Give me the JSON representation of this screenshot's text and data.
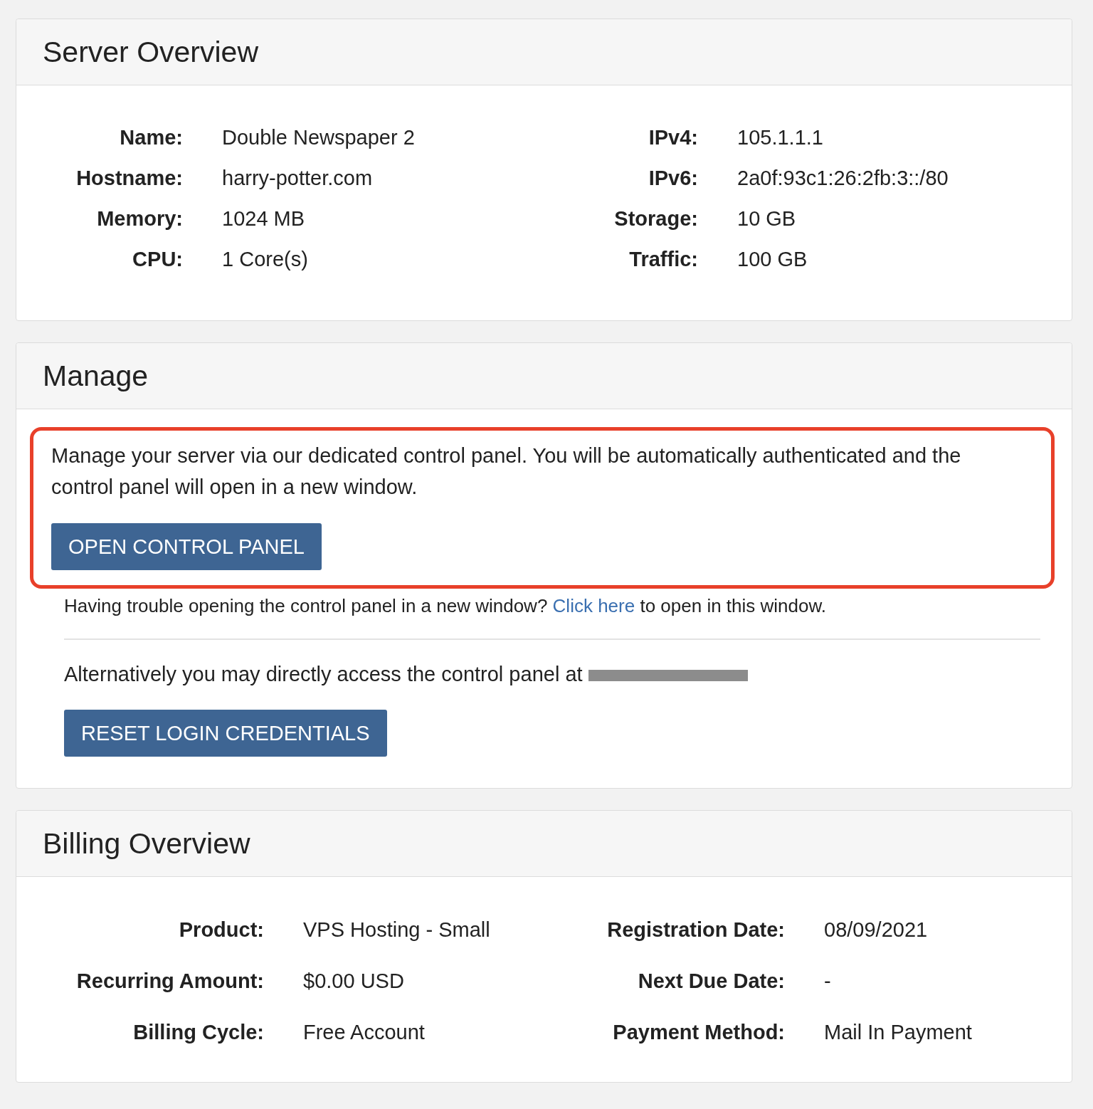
{
  "server_overview": {
    "title": "Server Overview",
    "left": [
      {
        "label": "Name:",
        "value": "Double Newspaper 2"
      },
      {
        "label": "Hostname:",
        "value": "harry-potter.com"
      },
      {
        "label": "Memory:",
        "value": "1024 MB"
      },
      {
        "label": "CPU:",
        "value": "1 Core(s)"
      }
    ],
    "right": [
      {
        "label": "IPv4:",
        "value": "105.1.1.1"
      },
      {
        "label": "IPv6:",
        "value": "2a0f:93c1:26:2fb:3::/80"
      },
      {
        "label": "Storage:",
        "value": "10 GB"
      },
      {
        "label": "Traffic:",
        "value": "100 GB"
      }
    ]
  },
  "manage": {
    "title": "Manage",
    "highlighted": true,
    "description": "Manage your server via our dedicated control panel. You will be automatically authenticated and the control panel will open in a new window.",
    "open_button": "OPEN CONTROL PANEL",
    "trouble_before": "Having trouble opening the control panel in a new window?",
    "trouble_link": "Click here",
    "trouble_after": "to open in this window.",
    "alternative_text": "Alternatively you may directly access the control panel at",
    "address_redacted": true,
    "reset_button": "RESET LOGIN CREDENTIALS"
  },
  "billing_overview": {
    "title": "Billing Overview",
    "left": [
      {
        "label": "Product:",
        "value": "VPS Hosting - Small"
      },
      {
        "label": "Recurring Amount:",
        "value": "$0.00 USD"
      },
      {
        "label": "Billing Cycle:",
        "value": "Free Account"
      }
    ],
    "right": [
      {
        "label": "Registration Date:",
        "value": "08/09/2021"
      },
      {
        "label": "Next Due Date:",
        "value": "-"
      },
      {
        "label": "Payment Method:",
        "value": "Mail In Payment"
      }
    ]
  }
}
